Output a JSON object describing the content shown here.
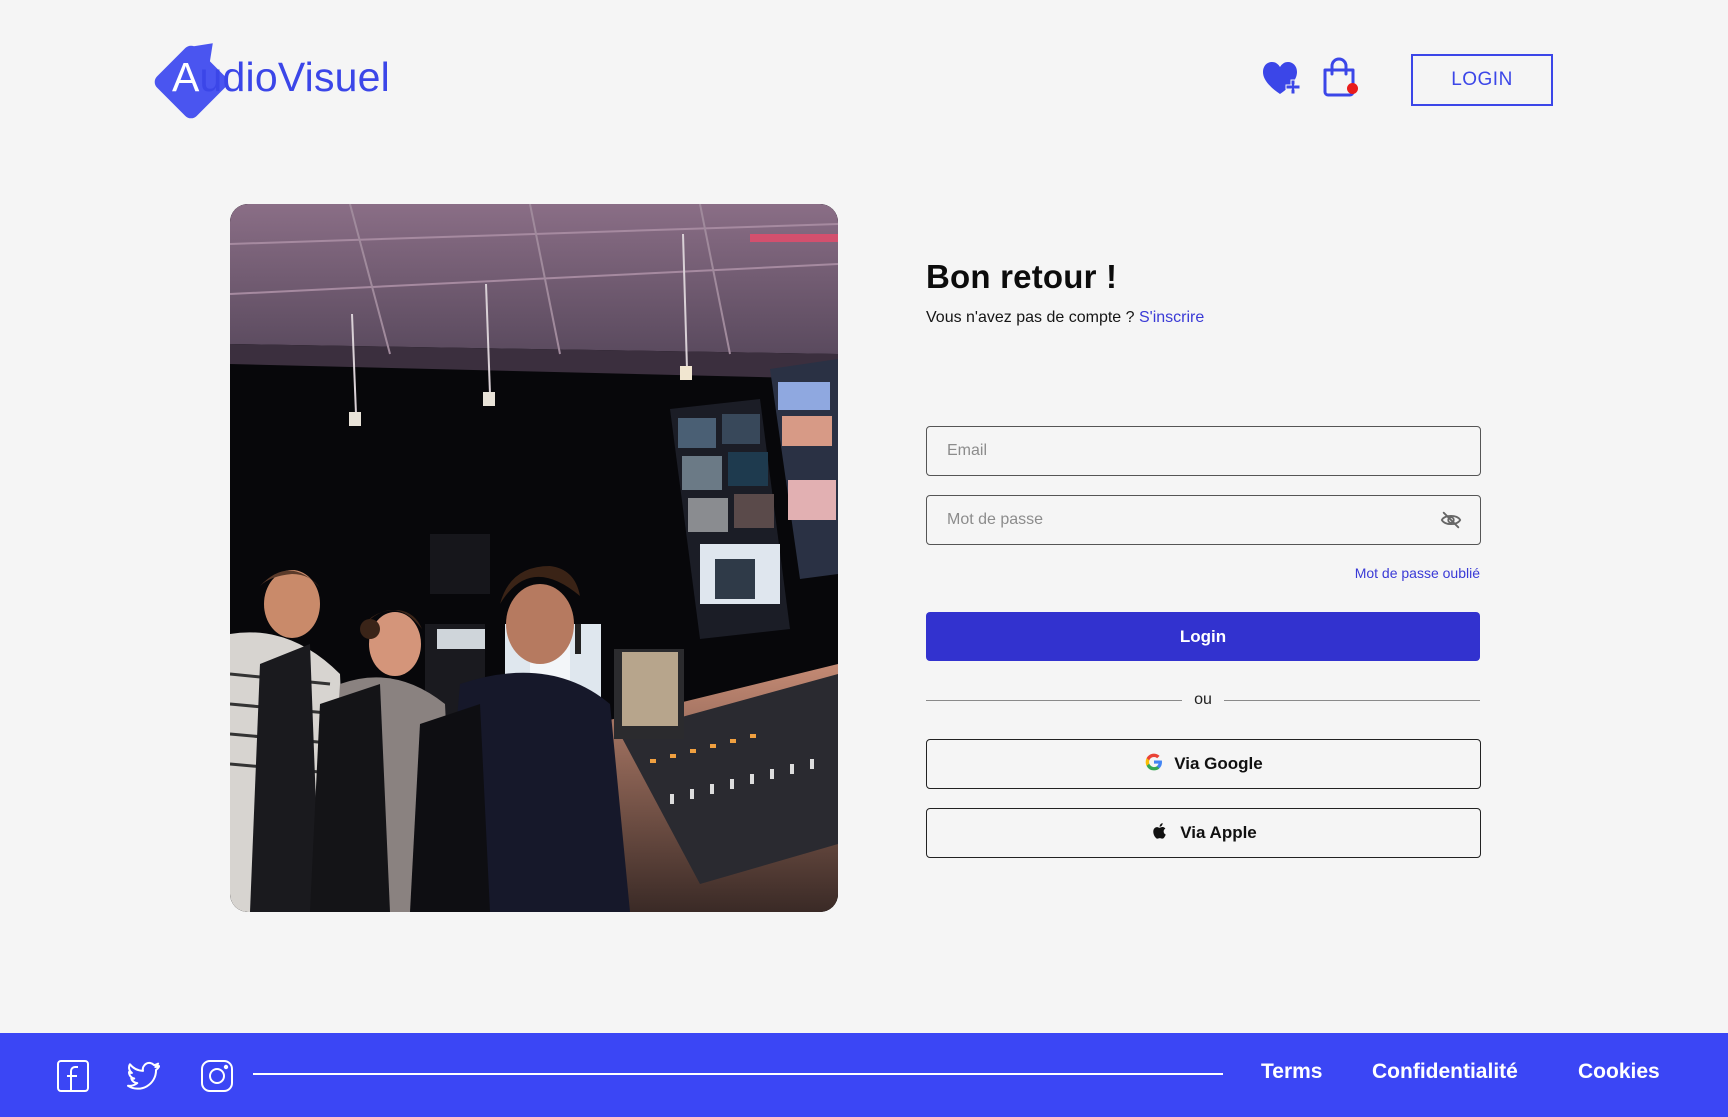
{
  "header": {
    "brand_first_letter": "A",
    "brand_rest": "udioVisuel",
    "login_label": "LOGIN"
  },
  "form": {
    "title": "Bon retour !",
    "subtitle": "Vous n'avez pas de compte ?",
    "signup_link": "S'inscrire",
    "email_placeholder": "Email",
    "password_placeholder": "Mot de passe",
    "forgot_password": "Mot de passe oublié",
    "login_button": "Login",
    "or_label": "ou",
    "google_button": "Via Google",
    "apple_button": "Via Apple"
  },
  "footer": {
    "links": [
      "Terms",
      "Confidentialité",
      "Cookies"
    ]
  },
  "icons": {
    "wishlist": "heart-plus-icon",
    "cart": "shopping-bag-icon",
    "password_toggle": "eye-off-icon",
    "google": "google-icon",
    "apple": "apple-icon",
    "facebook": "facebook-icon",
    "twitter": "twitter-icon",
    "instagram": "instagram-icon"
  },
  "colors": {
    "brand": "#3b46e8",
    "primary_button": "#3232cf",
    "footer_bg": "#3b46f5",
    "link": "#3a3ad6",
    "cart_badge": "#e81c1c",
    "page_bg": "#f5f5f5"
  }
}
